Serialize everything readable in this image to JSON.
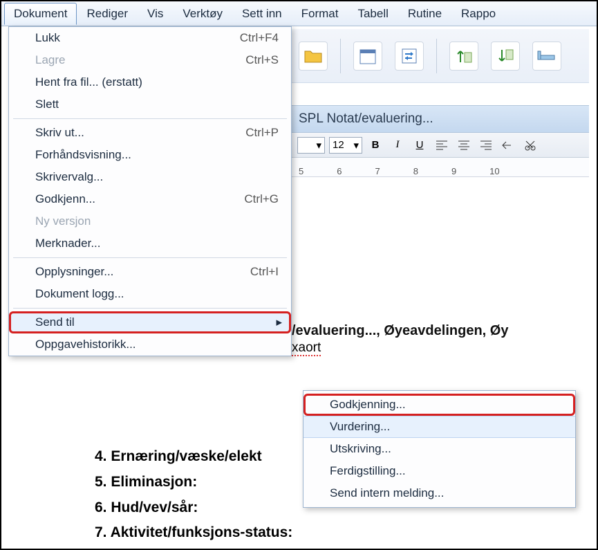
{
  "menubar": {
    "items": [
      "Dokument",
      "Rediger",
      "Vis",
      "Verktøy",
      "Sett inn",
      "Format",
      "Tabell",
      "Rutine",
      "Rappo"
    ]
  },
  "titleband": {
    "text": "SPL Notat/evaluering..."
  },
  "fmt": {
    "font_field": "",
    "size": "12",
    "bold": "B",
    "italic": "I",
    "underline": "U"
  },
  "ruler": {
    "marks": [
      "5",
      "6",
      "7",
      "8",
      "9",
      "10"
    ]
  },
  "dropdown": {
    "items": [
      {
        "label": "Lukk",
        "shortcut": "Ctrl+F4"
      },
      {
        "label": "Lagre",
        "shortcut": "Ctrl+S",
        "disabled": true
      },
      {
        "label": "Hent fra fil... (erstatt)"
      },
      {
        "label": "Slett"
      },
      {
        "sep": true
      },
      {
        "label": "Skriv ut...",
        "shortcut": "Ctrl+P"
      },
      {
        "label": "Forhåndsvisning..."
      },
      {
        "label": "Skrivervalg..."
      },
      {
        "label": "Godkjenn...",
        "shortcut": "Ctrl+G"
      },
      {
        "label": "Ny versjon",
        "disabled": true
      },
      {
        "label": "Merknader..."
      },
      {
        "sep": true
      },
      {
        "label": "Opplysninger...",
        "shortcut": "Ctrl+I"
      },
      {
        "label": "Dokument logg..."
      },
      {
        "sep": true
      },
      {
        "label": "Send til",
        "submenu": true,
        "highlight": true
      },
      {
        "label": "Oppgavehistorikk..."
      }
    ]
  },
  "submenu": {
    "items": [
      {
        "label": "Godkjenning...",
        "highlight": true
      },
      {
        "label": "Vurdering...",
        "hover": true
      },
      {
        "label": "Utskriving..."
      },
      {
        "label": "Ferdigstilling..."
      },
      {
        "label": "Send intern melding..."
      }
    ]
  },
  "doc": {
    "line_eval": "/evaluering..., Øyeavdelingen, Øy",
    "line_xaort": "xaort",
    "list": [
      "4. Ernæring/væske/elekt",
      "5. Eliminasjon:",
      "6. Hud/vev/sår:",
      "7. Aktivitet/funksjons-status:"
    ]
  }
}
